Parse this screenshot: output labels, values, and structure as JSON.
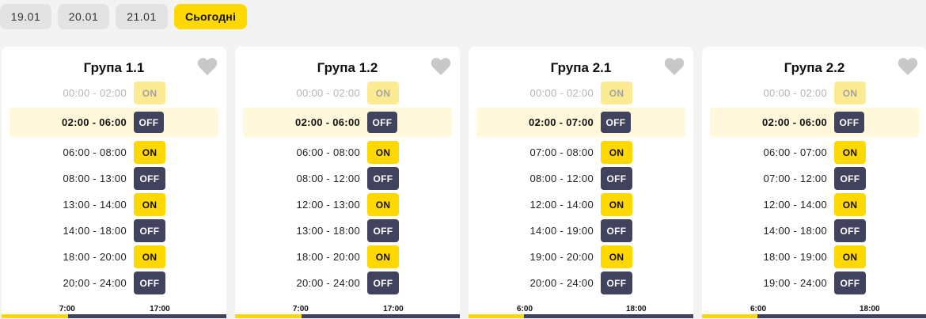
{
  "date_tabs": [
    {
      "label": "19.01"
    },
    {
      "label": "20.01"
    },
    {
      "label": "21.01"
    },
    {
      "label": "Сьогодні",
      "active": true
    }
  ],
  "colors": {
    "accent": "#ffd800",
    "off": "#40425e",
    "current_row": "#fff8db"
  },
  "groups": [
    {
      "title": "Група 1.1",
      "rows": [
        {
          "time": "00:00 - 02:00",
          "status": "ON",
          "state": "past"
        },
        {
          "time": "02:00 - 06:00",
          "status": "OFF",
          "state": "current"
        },
        {
          "time": "06:00 - 08:00",
          "status": "ON"
        },
        {
          "time": "08:00 - 13:00",
          "status": "OFF"
        },
        {
          "time": "13:00 - 14:00",
          "status": "ON"
        },
        {
          "time": "14:00 - 18:00",
          "status": "OFF"
        },
        {
          "time": "18:00 - 20:00",
          "status": "ON"
        },
        {
          "time": "20:00 - 24:00",
          "status": "OFF"
        }
      ],
      "timeline": {
        "start_label": "7:00",
        "end_label": "17:00"
      }
    },
    {
      "title": "Група 1.2",
      "rows": [
        {
          "time": "00:00 - 02:00",
          "status": "ON",
          "state": "past"
        },
        {
          "time": "02:00 - 06:00",
          "status": "OFF",
          "state": "current"
        },
        {
          "time": "06:00 - 08:00",
          "status": "ON"
        },
        {
          "time": "08:00 - 12:00",
          "status": "OFF"
        },
        {
          "time": "12:00 - 13:00",
          "status": "ON"
        },
        {
          "time": "13:00 - 18:00",
          "status": "OFF"
        },
        {
          "time": "18:00 - 20:00",
          "status": "ON"
        },
        {
          "time": "20:00 - 24:00",
          "status": "OFF"
        }
      ],
      "timeline": {
        "start_label": "7:00",
        "end_label": "17:00"
      }
    },
    {
      "title": "Група 2.1",
      "rows": [
        {
          "time": "00:00 - 02:00",
          "status": "ON",
          "state": "past"
        },
        {
          "time": "02:00 - 07:00",
          "status": "OFF",
          "state": "current"
        },
        {
          "time": "07:00 - 08:00",
          "status": "ON"
        },
        {
          "time": "08:00 - 12:00",
          "status": "OFF"
        },
        {
          "time": "12:00 - 14:00",
          "status": "ON"
        },
        {
          "time": "14:00 - 19:00",
          "status": "OFF"
        },
        {
          "time": "19:00 - 20:00",
          "status": "ON"
        },
        {
          "time": "20:00 - 24:00",
          "status": "OFF"
        }
      ],
      "timeline": {
        "start_label": "6:00",
        "end_label": "18:00"
      }
    },
    {
      "title": "Група 2.2",
      "rows": [
        {
          "time": "00:00 - 02:00",
          "status": "ON",
          "state": "past"
        },
        {
          "time": "02:00 - 06:00",
          "status": "OFF",
          "state": "current"
        },
        {
          "time": "06:00 - 07:00",
          "status": "ON"
        },
        {
          "time": "07:00 - 12:00",
          "status": "OFF"
        },
        {
          "time": "12:00 - 14:00",
          "status": "ON"
        },
        {
          "time": "14:00 - 18:00",
          "status": "OFF"
        },
        {
          "time": "18:00 - 19:00",
          "status": "ON"
        },
        {
          "time": "19:00 - 24:00",
          "status": "OFF"
        }
      ],
      "timeline": {
        "start_label": "6:00",
        "end_label": "18:00"
      }
    }
  ]
}
